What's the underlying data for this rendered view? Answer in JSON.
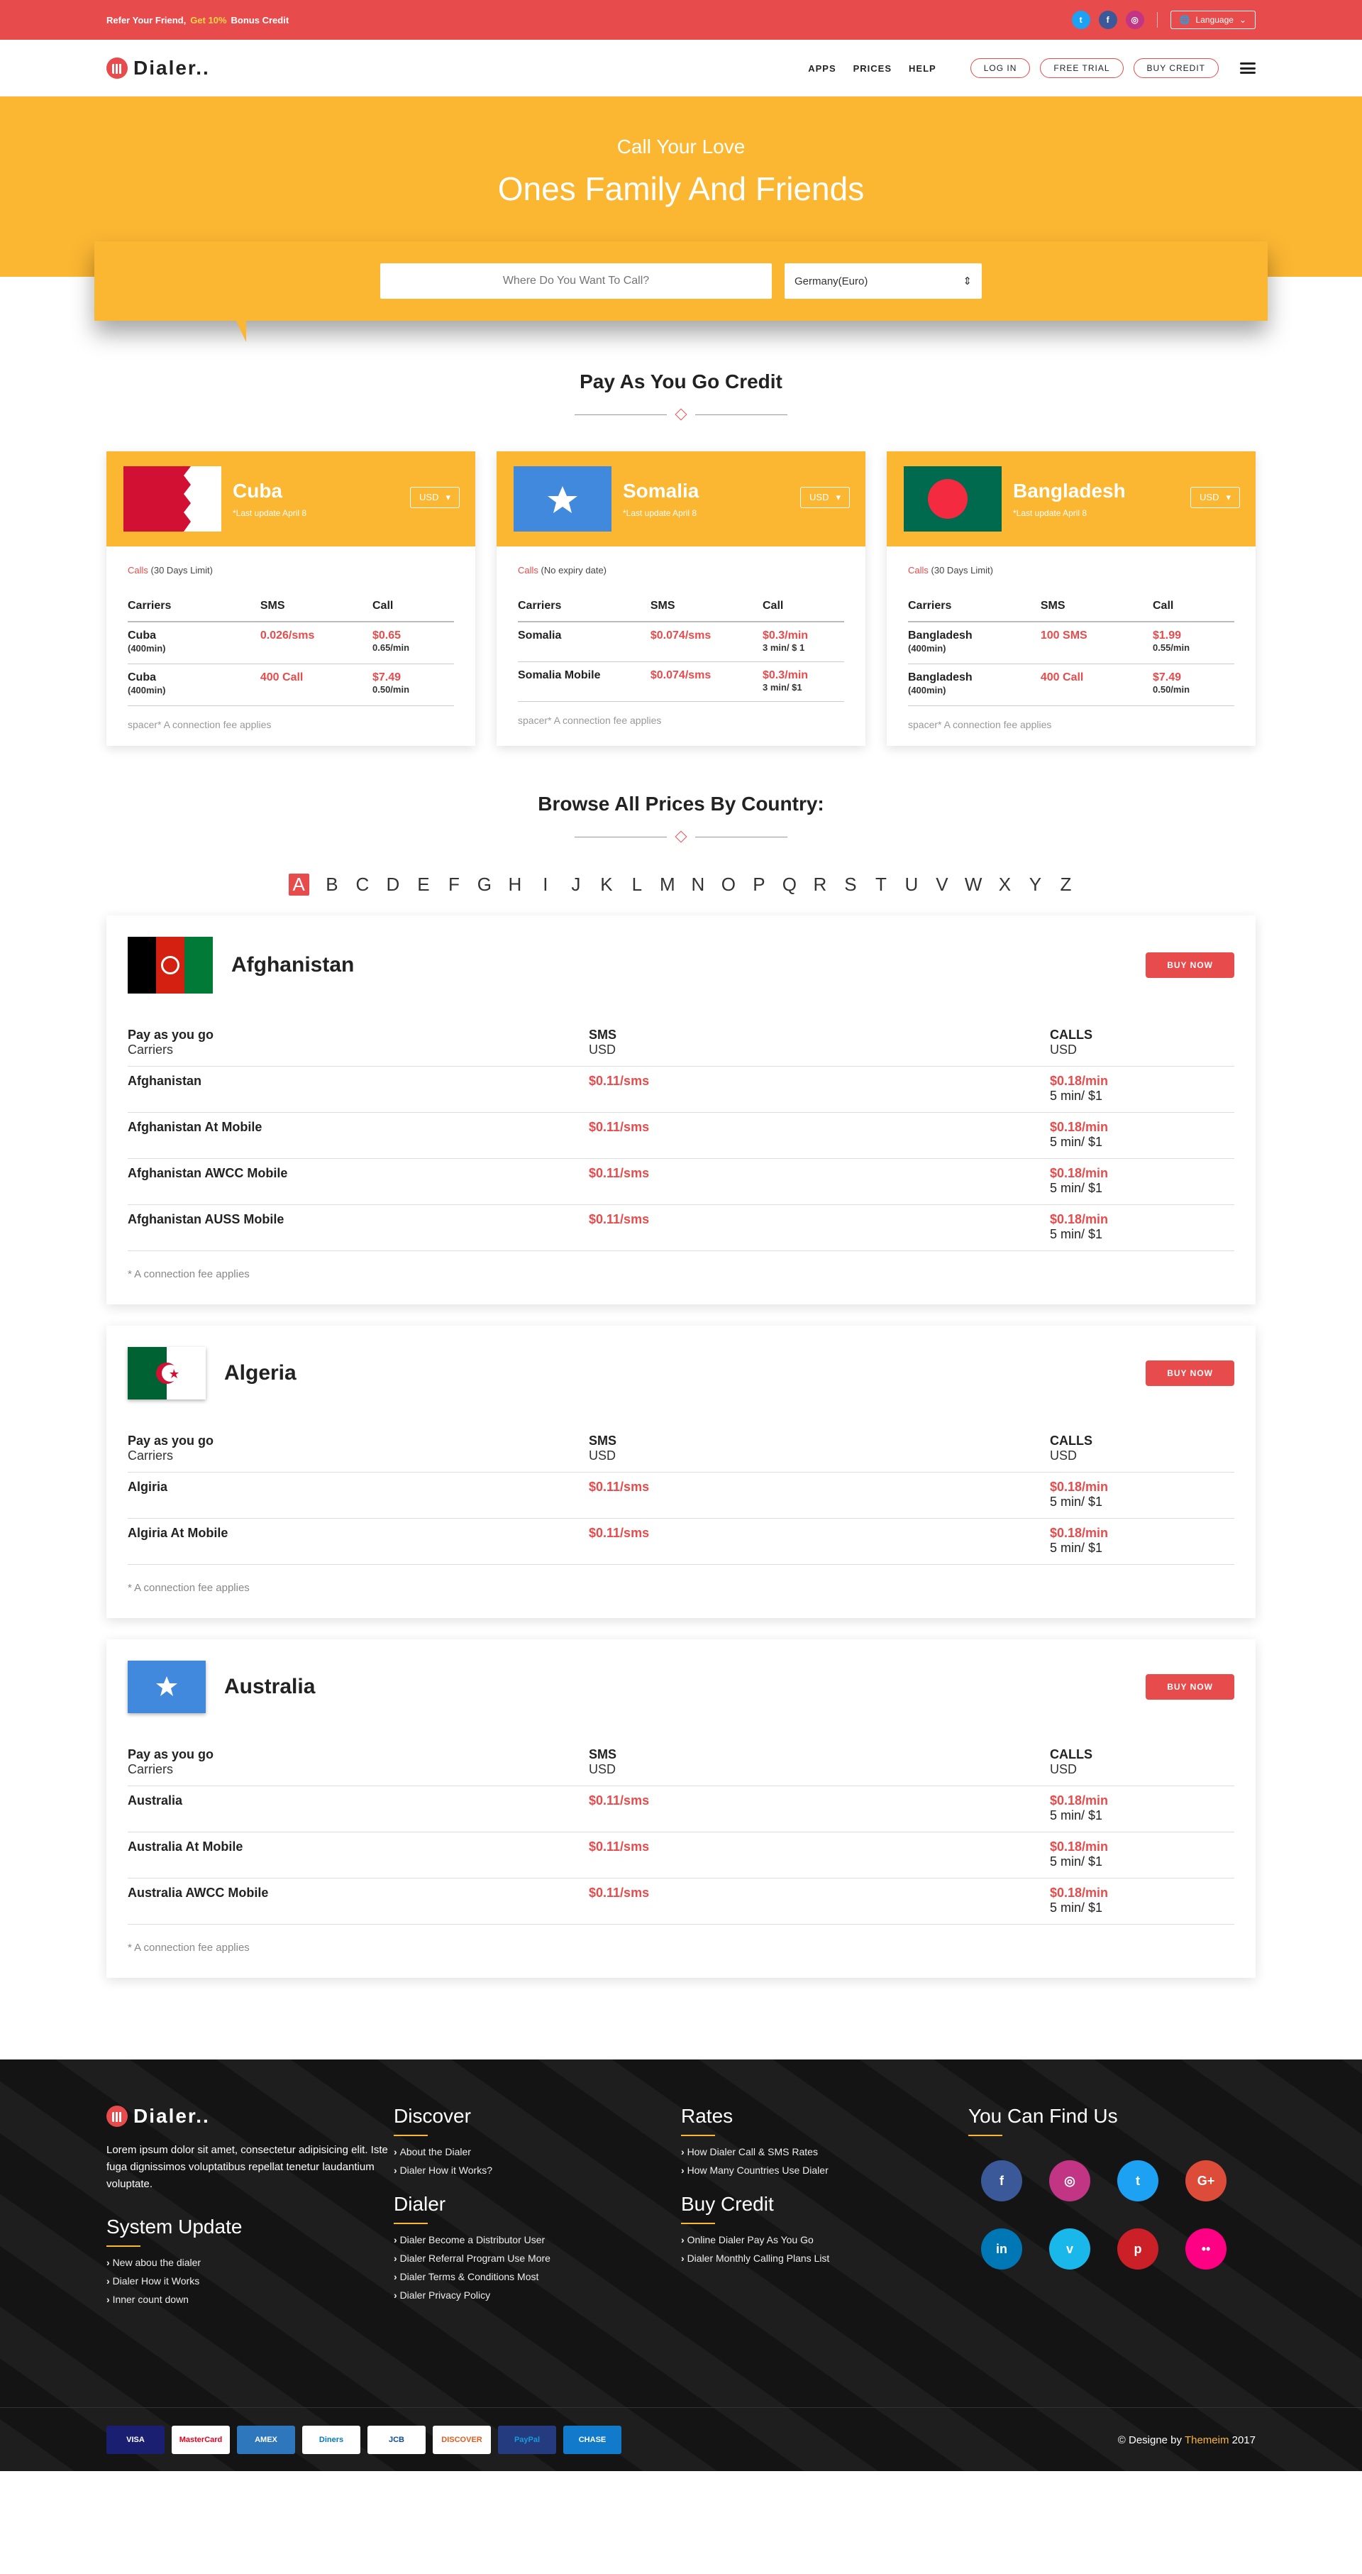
{
  "topbar": {
    "refer_a": "Refer Your Friend,",
    "refer_b": "Get 10%",
    "refer_c": "Bonus Credit",
    "language": "Language"
  },
  "nav": {
    "brand": "Dialer..",
    "links": [
      "APPS",
      "PRICES",
      "HELP"
    ],
    "buttons": [
      "LOG IN",
      "FREE TRIAL",
      "BUY CREDIT"
    ]
  },
  "hero": {
    "sub": "Call Your Love",
    "main": "Ones Family And Friends",
    "search_placeholder": "Where Do You Want To Call?",
    "select_value": "Germany(Euro)"
  },
  "payg": {
    "heading": "Pay As You Go Credit",
    "cards": [
      {
        "name": "Cuba",
        "update": "*Last update April 8",
        "currency": "USD",
        "limit_a": "Calls",
        "limit_b": "(30 Days Limit)",
        "header": [
          "Carriers",
          "SMS",
          "Call"
        ],
        "rows": [
          {
            "name": "Cuba",
            "sub": "(400min)",
            "sms": "0.026/sms",
            "call": "$0.65",
            "rate": "0.65/min"
          },
          {
            "name": "Cuba",
            "sub": "(400min)",
            "sms": "400 Call",
            "call": "$7.49",
            "rate": "0.50/min"
          }
        ],
        "fee": "spacer* A connection fee applies"
      },
      {
        "name": "Somalia",
        "update": "*Last update April 8",
        "currency": "USD",
        "limit_a": "Calls",
        "limit_b": "(No expiry date)",
        "header": [
          "Carriers",
          "SMS",
          "Call"
        ],
        "rows": [
          {
            "name": "Somalia",
            "sub": "",
            "sms": "$0.074/sms",
            "call": "$0.3/min",
            "rate": "3 min/ $ 1"
          },
          {
            "name": "Somalia Mobile",
            "sub": "",
            "sms": "$0.074/sms",
            "call": "$0.3/min",
            "rate": "3 min/ $1"
          }
        ],
        "fee": "spacer* A connection fee applies"
      },
      {
        "name": "Bangladesh",
        "update": "*Last update April 8",
        "currency": "USD",
        "limit_a": "Calls",
        "limit_b": "(30 Days Limit)",
        "header": [
          "Carriers",
          "SMS",
          "Call"
        ],
        "rows": [
          {
            "name": "Bangladesh",
            "sub": "(400min)",
            "sms": "100 SMS",
            "call": "$1.99",
            "rate": "0.55/min"
          },
          {
            "name": "Bangladesh",
            "sub": "(400min)",
            "sms": "400 Call",
            "call": "$7.49",
            "rate": "0.50/min"
          }
        ],
        "fee": "spacer* A connection fee applies"
      }
    ]
  },
  "browse": {
    "heading": "Browse All Prices By Country:",
    "letters": [
      "A",
      "B",
      "C",
      "D",
      "E",
      "F",
      "G",
      "H",
      "I",
      "J",
      "K",
      "L",
      "M",
      "N",
      "O",
      "P",
      "Q",
      "R",
      "S",
      "T",
      "U",
      "V",
      "W",
      "X",
      "Y",
      "Z"
    ],
    "active": "A"
  },
  "countries": [
    {
      "name": "Afghanistan",
      "buy": "BUY NOW",
      "h1": "Pay as you go",
      "h1b": "Carriers",
      "h2": "SMS",
      "h2b": "USD",
      "h3": "CALLS",
      "h3b": "USD",
      "rows": [
        {
          "n": "Afghanistan",
          "sms": "$0.11/sms",
          "call": "$0.18/min",
          "rate": "5 min/ $1"
        },
        {
          "n": "Afghanistan At Mobile",
          "sms": "$0.11/sms",
          "call": "$0.18/min",
          "rate": "5 min/ $1"
        },
        {
          "n": "Afghanistan AWCC Mobile",
          "sms": "$0.11/sms",
          "call": "$0.18/min",
          "rate": "5 min/ $1"
        },
        {
          "n": "Afghanistan AUSS Mobile",
          "sms": "$0.11/sms",
          "call": "$0.18/min",
          "rate": "5 min/ $1"
        }
      ],
      "fee": "* A connection fee applies"
    },
    {
      "name": "Algeria",
      "buy": "BUY NOW",
      "h1": "Pay as you go",
      "h1b": "Carriers",
      "h2": "SMS",
      "h2b": "USD",
      "h3": "CALLS",
      "h3b": "USD",
      "rows": [
        {
          "n": "Algiria",
          "sms": "$0.11/sms",
          "call": "$0.18/min",
          "rate": "5 min/ $1"
        },
        {
          "n": "Algiria At Mobile",
          "sms": "$0.11/sms",
          "call": "$0.18/min",
          "rate": "5 min/ $1"
        }
      ],
      "fee": "* A connection fee applies"
    },
    {
      "name": "Australia",
      "buy": "BUY NOW",
      "h1": "Pay as you go",
      "h1b": "Carriers",
      "h2": "SMS",
      "h2b": "USD",
      "h3": "CALLS",
      "h3b": "USD",
      "rows": [
        {
          "n": "Australia",
          "sms": "$0.11/sms",
          "call": "$0.18/min",
          "rate": "5 min/ $1"
        },
        {
          "n": "Australia At Mobile",
          "sms": "$0.11/sms",
          "call": "$0.18/min",
          "rate": "5 min/ $1"
        },
        {
          "n": "Australia AWCC Mobile",
          "sms": "$0.11/sms",
          "call": "$0.18/min",
          "rate": "5 min/ $1"
        }
      ],
      "fee": "* A connection fee applies"
    }
  ],
  "footer": {
    "brand": "Dialer..",
    "desc": "Lorem ipsum dolor sit amet, consectetur adipisicing elit. Iste fuga dignissimos voluptatibus repellat tenetur laudantium voluptate.",
    "system_title": "System Update",
    "system_links": [
      "New abou the dialer",
      "Dialer How it Works",
      "Inner count down"
    ],
    "discover_title": "Discover",
    "discover_links": [
      "About the Dialer",
      "Dialer How it Works?"
    ],
    "dialer_title": "Dialer",
    "dialer_links": [
      "Dialer Become a Distributor User",
      "Dialer Referral Program Use More",
      "Dialer Terms & Conditions Most",
      "Dialer Privacy Policy"
    ],
    "rates_title": "Rates",
    "rates_links": [
      "How Dialer Call & SMS Rates",
      "How Many Countries Use Dialer"
    ],
    "buy_title": "Buy Credit",
    "buy_links": [
      "Online Dialer Pay As You Go",
      "Dialer Monthly Calling Plans List"
    ],
    "find_title": "You Can Find Us",
    "social": [
      {
        "icon": "facebook-icon",
        "g": "f",
        "c": "#3b5998"
      },
      {
        "icon": "instagram-icon",
        "g": "◎",
        "c": "#c13584"
      },
      {
        "icon": "twitter-icon",
        "g": "t",
        "c": "#1da1f2"
      },
      {
        "icon": "google-plus-icon",
        "g": "G+",
        "c": "#dd4b39"
      },
      {
        "icon": "linkedin-icon",
        "g": "in",
        "c": "#0077b5"
      },
      {
        "icon": "vimeo-icon",
        "g": "v",
        "c": "#1ab7ea"
      },
      {
        "icon": "pinterest-icon",
        "g": "p",
        "c": "#cb2027"
      },
      {
        "icon": "flickr-icon",
        "g": "••",
        "c": "#ff0084"
      }
    ],
    "payments": [
      "VISA",
      "MasterCard",
      "AMEX",
      "Diners",
      "JCB",
      "DISCOVER",
      "PayPal",
      "CHASE"
    ],
    "copy_a": "© Designe by",
    "copy_b": "Themeim",
    "copy_c": "2017"
  }
}
